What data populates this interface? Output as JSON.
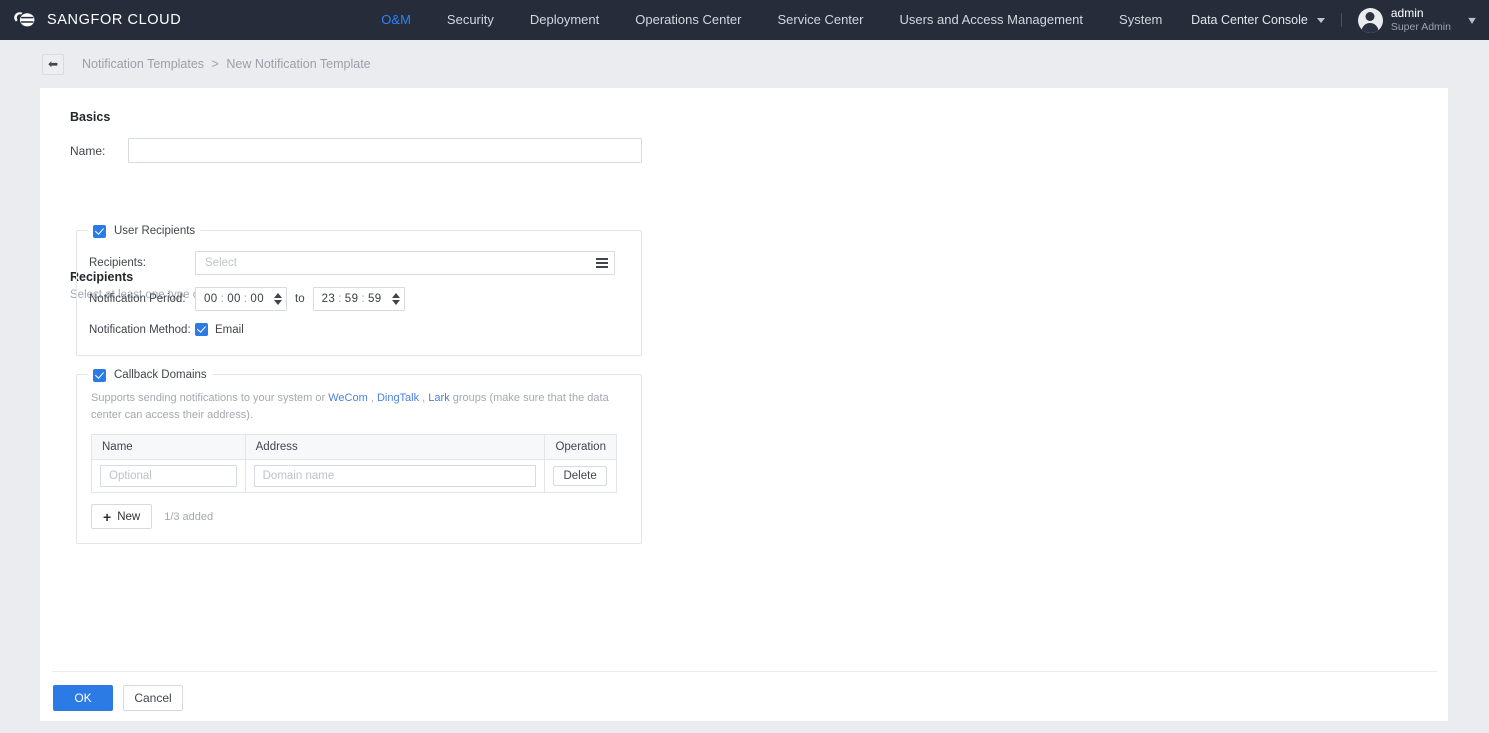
{
  "topbar": {
    "brand": "SANGFOR CLOUD",
    "logo_icon": "cloud-logo-icon",
    "nav": [
      {
        "label": "O&M",
        "active": true
      },
      {
        "label": "Security",
        "active": false
      },
      {
        "label": "Deployment",
        "active": false
      },
      {
        "label": "Operations Center",
        "active": false
      },
      {
        "label": "Service Center",
        "active": false
      },
      {
        "label": "Users and Access Management",
        "active": false
      },
      {
        "label": "System",
        "active": false
      }
    ],
    "console_selector": "Data Center Console",
    "user": {
      "name": "admin",
      "role": "Super Admin"
    },
    "accent": "#2c84f7",
    "background": "#262c3a"
  },
  "breadcrumb": {
    "back_icon": "back-arrow-icon",
    "parent": "Notification Templates",
    "separator": ">",
    "current": "New Notification Template"
  },
  "basics": {
    "title": "Basics",
    "name_label": "Name:",
    "name_value": "",
    "name_placeholder": ""
  },
  "recipients": {
    "title": "Recipients",
    "subtitle": "Select at least one type of recipients."
  },
  "user_recipients": {
    "legend": "User Recipients",
    "checked": true,
    "recipients_label": "Recipients:",
    "recipients_value": "",
    "recipients_placeholder": "Select",
    "select_icon": "list-select-icon",
    "period_label": "Notification Period:",
    "start_time": {
      "h": "00",
      "m": "00",
      "s": "00"
    },
    "to_word": "to",
    "end_time": {
      "h": "23",
      "m": "59",
      "s": "59"
    },
    "method_label": "Notification Method:",
    "method_option": "Email",
    "method_checked": true
  },
  "callback_domains": {
    "legend": "Callback Domains",
    "checked": true,
    "desc_part1": "Supports sending notifications to your system or ",
    "link_wecom": "WeCom",
    "desc_sep1": " , ",
    "link_dingtalk": "DingTalk",
    "desc_sep2": " , ",
    "link_lark": "Lark",
    "desc_part2": " groups (make sure that the data center can access their address).",
    "columns": [
      "Name",
      "Address",
      "Operation"
    ],
    "rows": [
      {
        "name_value": "",
        "name_placeholder": "Optional",
        "address_value": "",
        "address_placeholder": "Domain name",
        "delete_label": "Delete"
      }
    ],
    "new_button": "New",
    "new_icon": "plus-icon",
    "added_count": "1/3 added"
  },
  "footer": {
    "ok_label": "OK",
    "cancel_label": "Cancel",
    "primary_color": "#2c7be5"
  }
}
